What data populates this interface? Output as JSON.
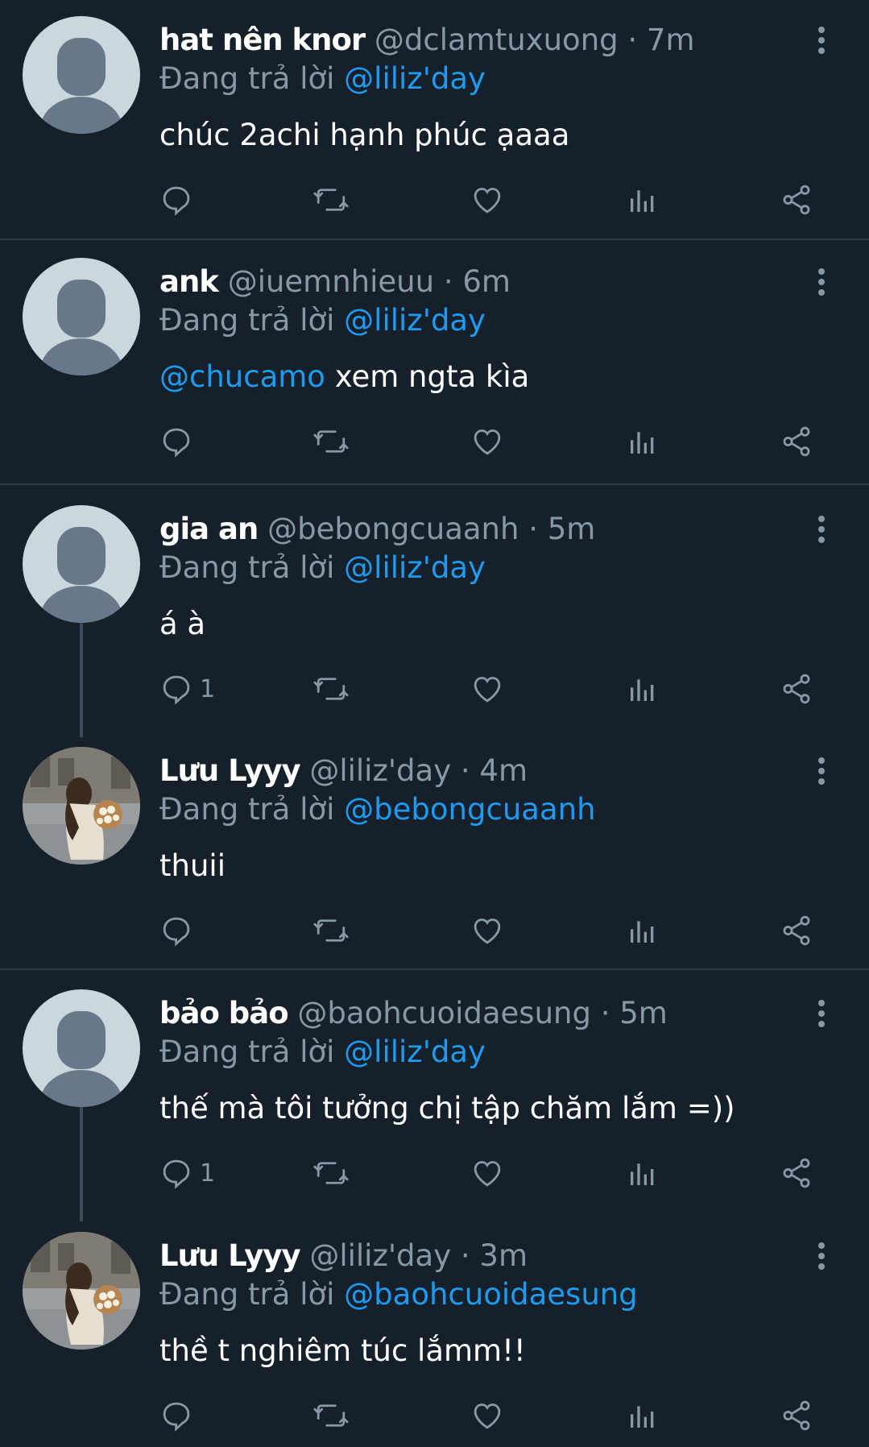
{
  "reply_prefix": "Đang trả lời",
  "colors": {
    "background": "#15202b",
    "text": "#ffffff",
    "muted": "#8899a6",
    "mention": "#1d9bf0",
    "divider": "#2c3845"
  },
  "icons": [
    "reply-icon",
    "retweet-icon",
    "like-icon",
    "analytics-icon",
    "share-icon",
    "more-icon",
    "default-avatar-icon"
  ],
  "tweets": [
    {
      "display_name": "hat nên knor",
      "handle": "@dclamtuxuong",
      "time": "7m",
      "reply_to": "@liliz'day",
      "text_mention": "",
      "text": "chúc 2achi hạnh phúc ạaaa",
      "reply_count": ""
    },
    {
      "display_name": "ank",
      "handle": "@iuemnhieuu",
      "time": "6m",
      "reply_to": "@liliz'day",
      "text_mention": "@chucamo",
      "text": " xem ngta kìa",
      "reply_count": ""
    },
    {
      "display_name": "gia an",
      "handle": "@bebongcuaanh",
      "time": "5m",
      "reply_to": "@liliz'day",
      "text_mention": "",
      "text": "á à",
      "reply_count": "1"
    },
    {
      "display_name": "Lưu Lyyy",
      "handle": "@liliz'day",
      "time": "4m",
      "reply_to": "@bebongcuaanh",
      "text_mention": "",
      "text": "thuii",
      "reply_count": ""
    },
    {
      "display_name": "bảo bảo",
      "handle": "@baohcuoidaesung",
      "time": "5m",
      "reply_to": "@liliz'day",
      "text_mention": "",
      "text": "thế mà tôi tưởng chị tập chăm lắm =))",
      "reply_count": "1"
    },
    {
      "display_name": "Lưu Lyyy",
      "handle": "@liliz'day",
      "time": "3m",
      "reply_to": "@baohcuoidaesung",
      "text_mention": "",
      "text": "thề t nghiêm túc lắmm!!",
      "reply_count": ""
    }
  ]
}
